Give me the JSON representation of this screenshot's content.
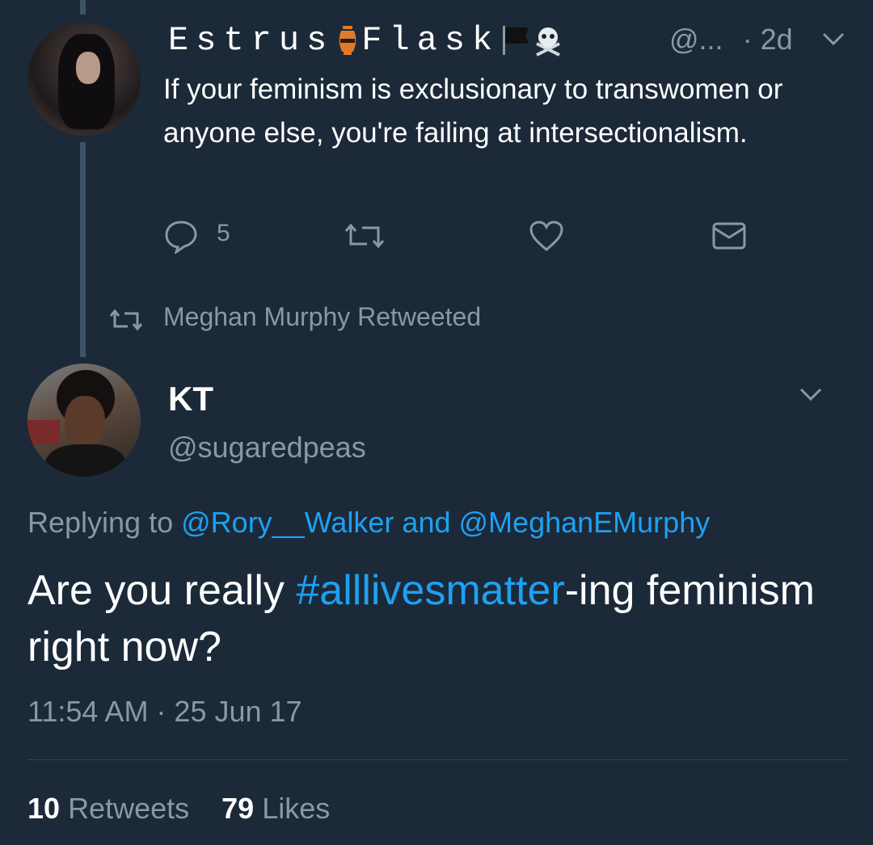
{
  "first_tweet": {
    "display_name_part1": "Estrus",
    "display_name_part2": "Flask",
    "handle": "@...",
    "time": "· 2d",
    "text": "If your feminism is exclusionary to transwomen or anyone else, you're failing at intersectionalism.",
    "reply_count": "5",
    "icons": [
      "reply-icon",
      "retweet-icon",
      "like-icon",
      "direct-message-icon"
    ]
  },
  "retweet_notice": {
    "label": "Meghan Murphy Retweeted"
  },
  "main_tweet": {
    "name": "KT",
    "handle": "@sugaredpeas",
    "replying_prefix": "Replying to",
    "reply_mention1": "@Rory__Walker",
    "reply_and": "and",
    "reply_mention2": "@MeghanEMurphy",
    "text_before": "Are you really ",
    "hashtag": "#alllivesmatter",
    "text_after": "-ing feminism right now?",
    "timestamp": "11:54 AM · 25 Jun 17",
    "retweets_count": "10",
    "retweets_label": "Retweets",
    "likes_count": "79",
    "likes_label": "Likes"
  },
  "colors": {
    "background": "#1c2938",
    "text_secondary": "#8899a6",
    "link": "#1da1f2",
    "thread_line": "#3d5466"
  }
}
